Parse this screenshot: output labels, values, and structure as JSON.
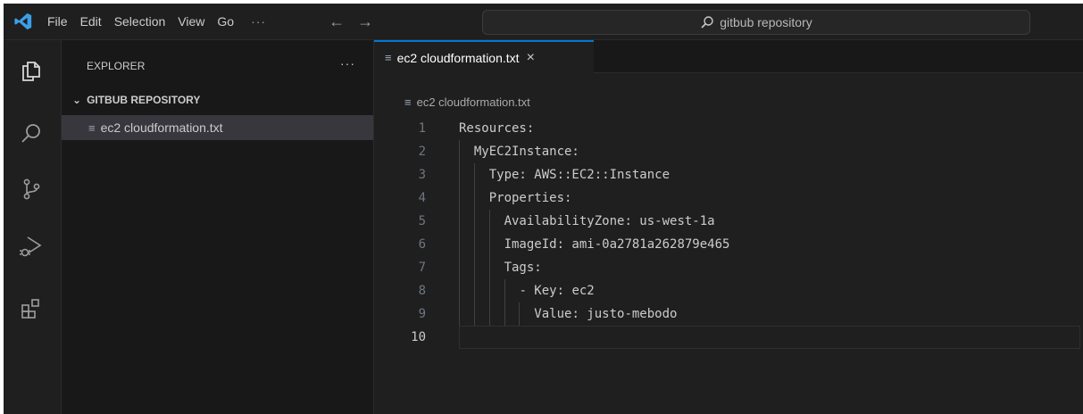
{
  "menu": [
    "File",
    "Edit",
    "Selection",
    "View",
    "Go"
  ],
  "menu_more": "···",
  "search": {
    "text": "gitbub repository"
  },
  "sidebar": {
    "header": "EXPLORER",
    "more": "···",
    "folder": "GITBUB REPOSITORY",
    "file": "ec2 cloudformation.txt"
  },
  "tab": {
    "label": "ec2 cloudformation.txt",
    "close": "×"
  },
  "breadcrumb": "ec2 cloudformation.txt",
  "code": [
    {
      "n": "1",
      "indent": 0,
      "text": "Resources:"
    },
    {
      "n": "2",
      "indent": 1,
      "text": "MyEC2Instance:"
    },
    {
      "n": "3",
      "indent": 2,
      "text": "Type: AWS::EC2::Instance"
    },
    {
      "n": "4",
      "indent": 2,
      "text": "Properties:"
    },
    {
      "n": "5",
      "indent": 3,
      "text": "AvailabilityZone: us-west-1a"
    },
    {
      "n": "6",
      "indent": 3,
      "text": "ImageId: ami-0a2781a262879e465"
    },
    {
      "n": "7",
      "indent": 3,
      "text": "Tags:"
    },
    {
      "n": "8",
      "indent": 4,
      "text": "- Key: ec2"
    },
    {
      "n": "9",
      "indent": 5,
      "text": "Value: justo-mebodo"
    },
    {
      "n": "10",
      "indent": 0,
      "text": "",
      "active": true
    }
  ],
  "colors": {
    "accent": "#0078d4",
    "vscode_blue": "#3b9fe8"
  }
}
